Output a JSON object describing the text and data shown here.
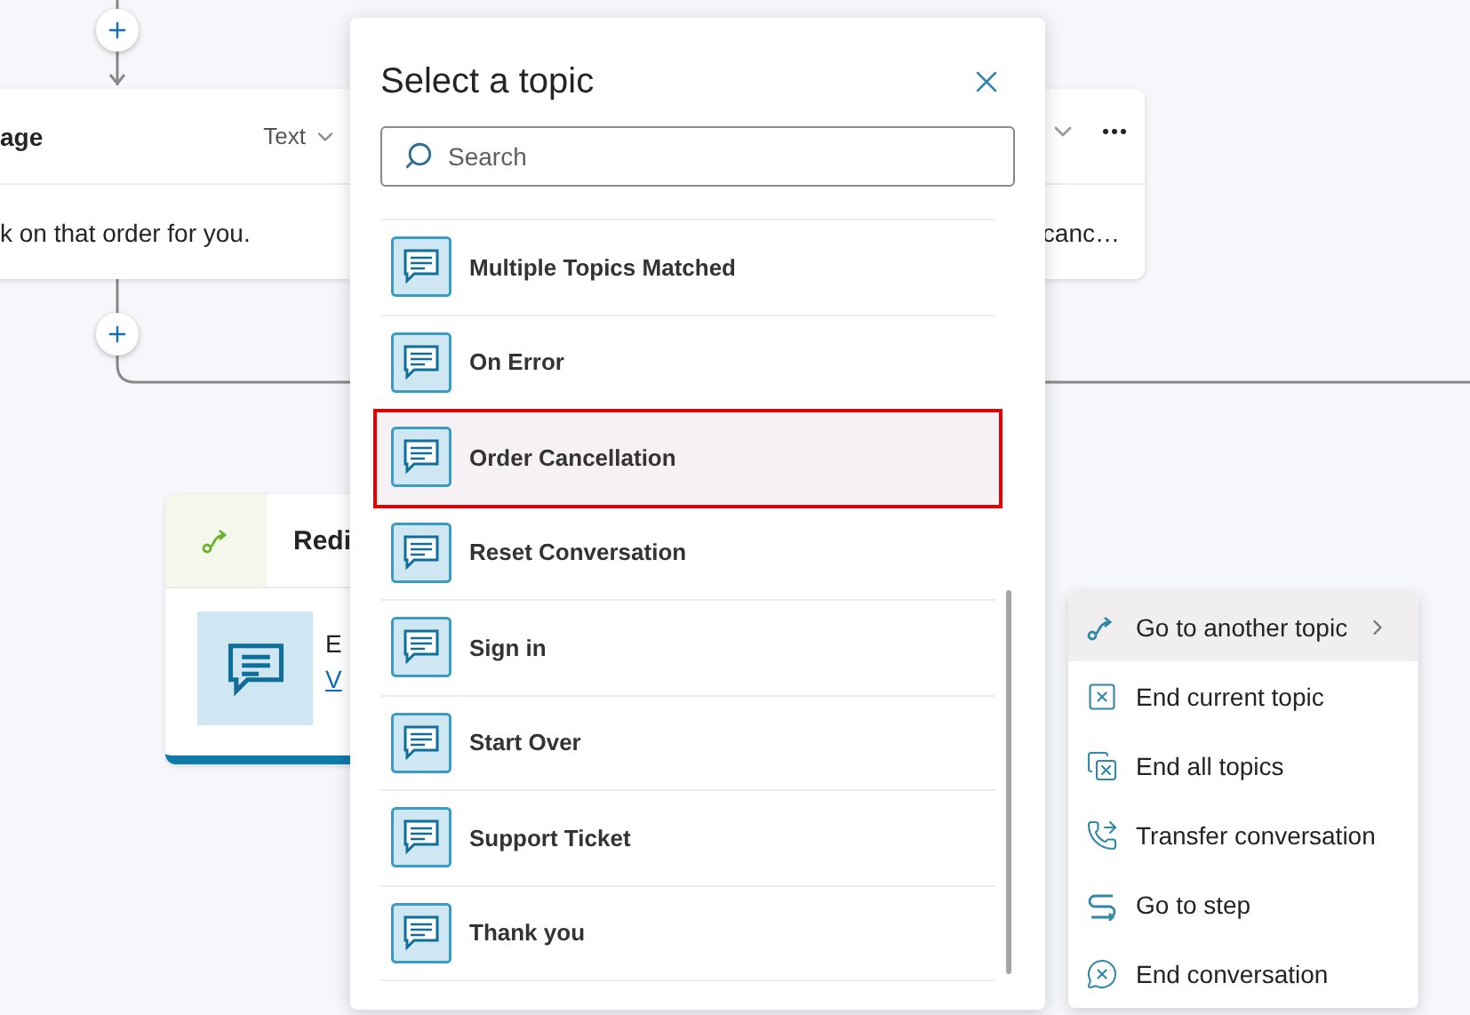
{
  "canvas": {
    "message_card": {
      "title": "age",
      "type_label": "Text",
      "body": "k on that order for you.",
      "body_end": "canc…"
    },
    "redirect_card": {
      "title": "Redi",
      "line": "E",
      "link": "V"
    }
  },
  "topic_dialog": {
    "title": "Select a topic",
    "search": {
      "placeholder": "Search"
    },
    "topics": [
      {
        "label": "Multiple Topics Matched",
        "selected": false
      },
      {
        "label": "On Error",
        "selected": false
      },
      {
        "label": "Order Cancellation",
        "selected": true
      },
      {
        "label": "Reset Conversation",
        "selected": false
      },
      {
        "label": "Sign in",
        "selected": false
      },
      {
        "label": "Start Over",
        "selected": false
      },
      {
        "label": "Support Ticket",
        "selected": false
      },
      {
        "label": "Thank you",
        "selected": false
      }
    ]
  },
  "action_menu": {
    "items": [
      {
        "kind": "redirect",
        "label": "Go to another topic",
        "selected": true,
        "submenu": true
      },
      {
        "kind": "end-topic",
        "label": "End current topic",
        "selected": false,
        "submenu": false
      },
      {
        "kind": "end-all",
        "label": "End all topics",
        "selected": false,
        "submenu": false
      },
      {
        "kind": "transfer",
        "label": "Transfer conversation",
        "selected": false,
        "submenu": false
      },
      {
        "kind": "goto-step",
        "label": "Go to step",
        "selected": false,
        "submenu": false
      },
      {
        "kind": "end-conversation",
        "label": "End conversation",
        "selected": false,
        "submenu": false
      }
    ]
  }
}
